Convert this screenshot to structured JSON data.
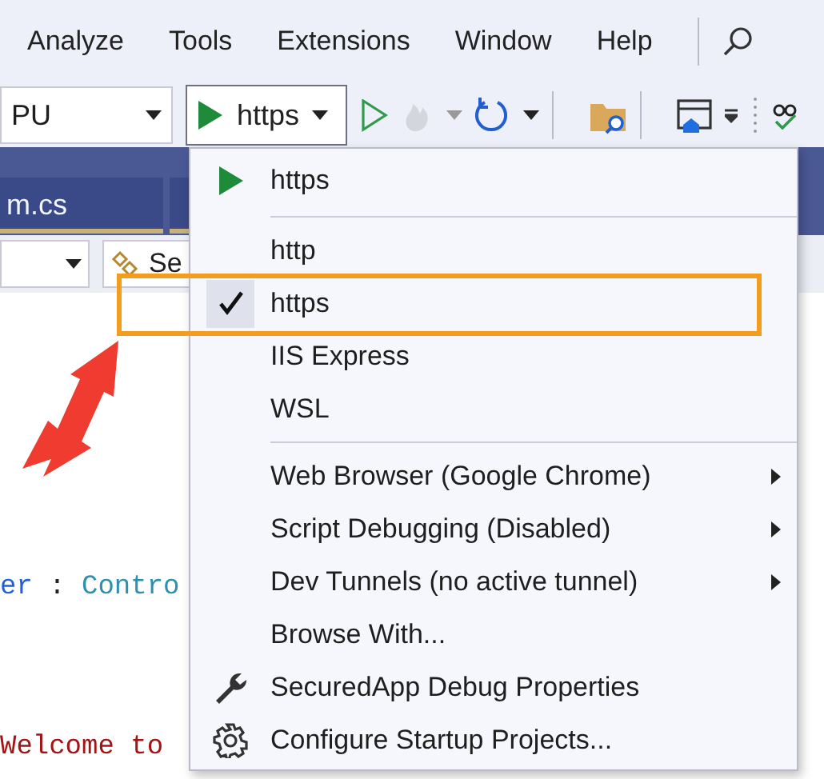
{
  "menu_bar": [
    "Analyze",
    "Tools",
    "Extensions",
    "Window",
    "Help"
  ],
  "toolbar": {
    "platform": "PU",
    "run_profile": "https"
  },
  "tabs": [
    {
      "label": "m.cs",
      "selected": false
    }
  ],
  "nav_bar": {
    "member": "Se"
  },
  "code_lines": [
    {
      "tokens": [
        {
          "text": "er",
          "kind": "keyword"
        },
        {
          "text": " : ",
          "kind": "plain"
        },
        {
          "text": "Contro",
          "kind": "type"
        }
      ]
    },
    {
      "tokens": [
        {
          "text": "Welcome to",
          "kind": "string"
        }
      ]
    }
  ],
  "dropdown": {
    "items": [
      {
        "kind": "run",
        "label": "https"
      },
      {
        "kind": "separator"
      },
      {
        "kind": "option",
        "label": "http",
        "checked": false,
        "highlighted": false
      },
      {
        "kind": "option",
        "label": "https",
        "checked": true,
        "highlighted": true
      },
      {
        "kind": "option",
        "label": "IIS Express",
        "checked": false,
        "highlighted": false
      },
      {
        "kind": "option",
        "label": "WSL",
        "checked": false,
        "highlighted": false
      },
      {
        "kind": "separator"
      },
      {
        "kind": "submenu",
        "label": "Web Browser (Google Chrome)"
      },
      {
        "kind": "submenu",
        "label": "Script Debugging (Disabled)"
      },
      {
        "kind": "submenu",
        "label": "Dev Tunnels (no active tunnel)"
      },
      {
        "kind": "command",
        "label": "Browse With..."
      },
      {
        "kind": "properties",
        "label": "SecuredApp Debug Properties"
      },
      {
        "kind": "configure",
        "label": "Configure Startup Projects..."
      }
    ]
  },
  "annotations": [
    {
      "kind": "arrow"
    }
  ]
}
